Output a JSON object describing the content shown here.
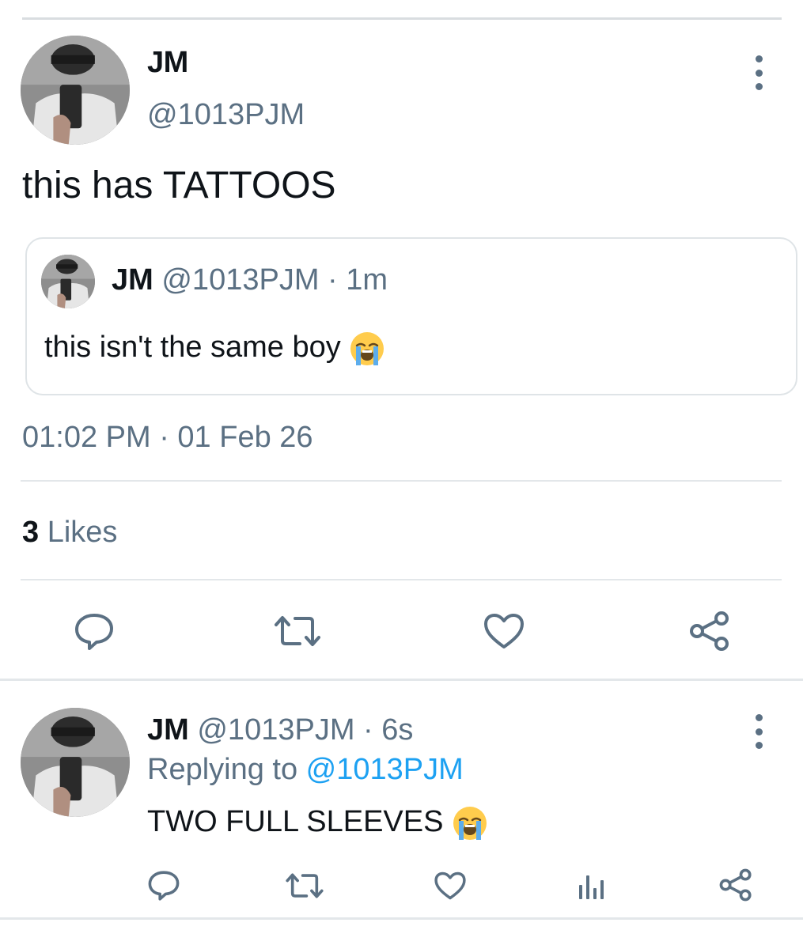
{
  "colors": {
    "text_primary": "#0f1419",
    "text_secondary": "#5b7083",
    "link": "#1da1f2",
    "divider": "#e3e7ea"
  },
  "main_tweet": {
    "display_name": "JM",
    "handle": "@1013PJM",
    "text": "this has TATTOOS",
    "quoted": {
      "display_name": "JM",
      "handle": "@1013PJM",
      "time": " · 1m",
      "text": "this isn't the same boy "
    },
    "timestamp": "01:02 PM · 01 Feb 26",
    "likes_count": "3",
    "likes_label": " Likes",
    "actions": [
      "reply-icon",
      "retweet-icon",
      "like-icon",
      "share-icon"
    ]
  },
  "reply_tweet": {
    "display_name": "JM",
    "handle": "@1013PJM",
    "time": " · 6s",
    "replying_prefix": "Replying to ",
    "replying_handle": "@1013PJM",
    "text": "TWO FULL SLEEVES ",
    "actions": [
      "reply-icon",
      "retweet-icon",
      "like-icon",
      "analytics-icon",
      "share-icon"
    ]
  }
}
